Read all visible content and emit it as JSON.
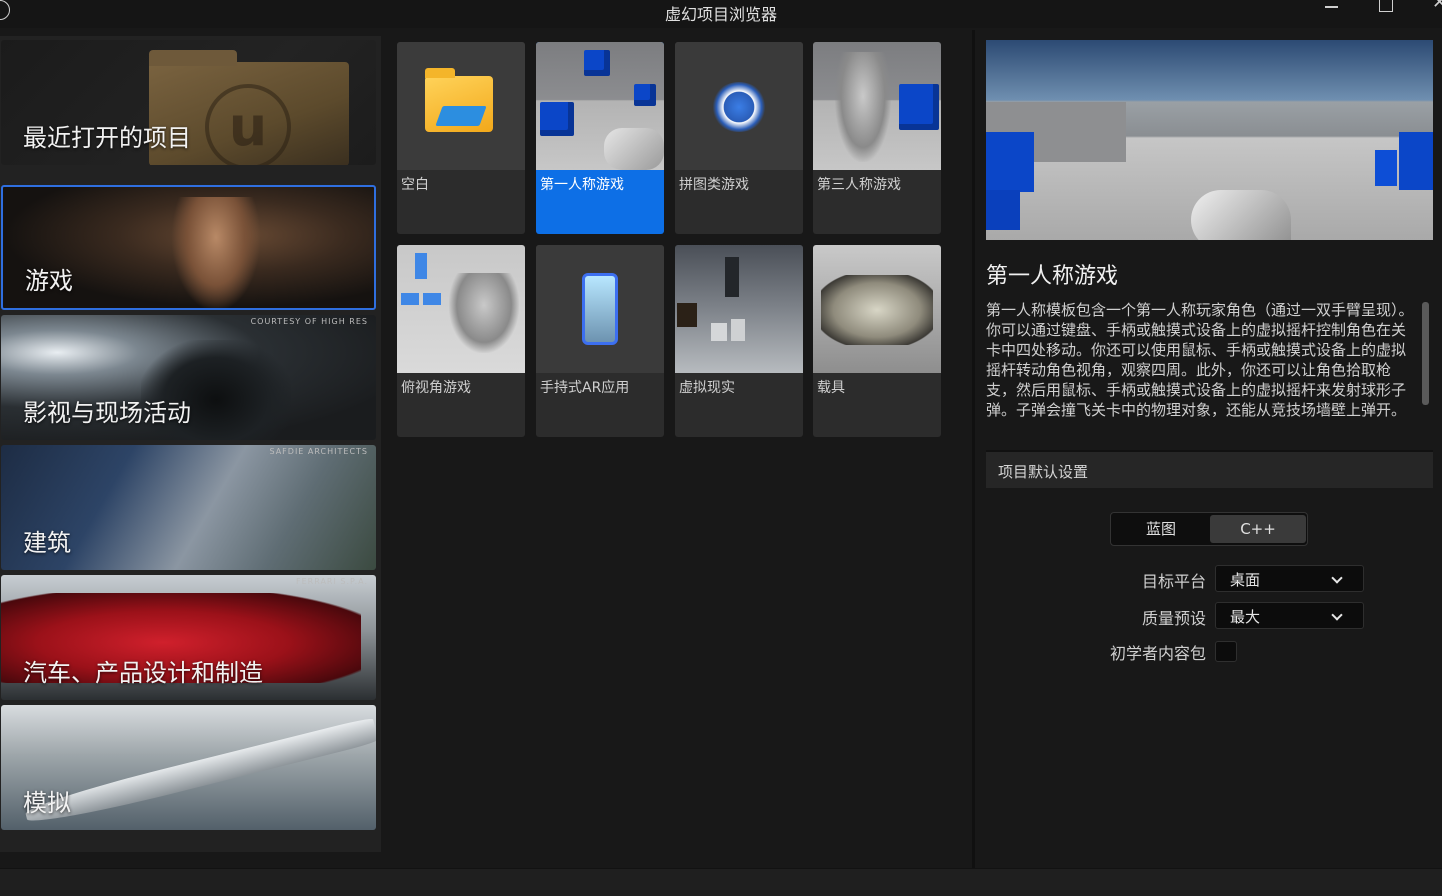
{
  "window": {
    "title": "虚幻项目浏览器"
  },
  "categories": [
    {
      "label": "最近打开的项目",
      "credit": ""
    },
    {
      "label": "游戏",
      "credit": ""
    },
    {
      "label": "影视与现场活动",
      "credit": "COURTESY OF HIGH RES"
    },
    {
      "label": "建筑",
      "credit": "SAFDIE ARCHITECTS"
    },
    {
      "label": "汽车、产品设计和制造",
      "credit": "FERRARI S.P.A."
    },
    {
      "label": "模拟",
      "credit": ""
    }
  ],
  "templates": [
    {
      "name": "空白"
    },
    {
      "name": "第一人称游戏"
    },
    {
      "name": "拼图类游戏"
    },
    {
      "name": "第三人称游戏"
    },
    {
      "name": "俯视角游戏"
    },
    {
      "name": "手持式AR应用"
    },
    {
      "name": "虚拟现实"
    },
    {
      "name": "载具"
    }
  ],
  "details": {
    "title": "第一人称游戏",
    "description": "第一人称模板包含一个第一人称玩家角色（通过一双手臂呈现）。你可以通过键盘、手柄或触摸式设备上的虚拟摇杆控制角色在关卡中四处移动。你还可以使用鼠标、手柄或触摸式设备上的虚拟摇杆转动角色视角，观察四周。此外，你还可以让角色拾取枪支，然后用鼠标、手柄或触摸式设备上的虚拟摇杆来发射球形子弹。子弹会撞飞关卡中的物理对象，还能从竞技场墙壁上弹开。",
    "section_title": "项目默认设置",
    "toggle": {
      "blueprint": "蓝图",
      "cpp": "C++",
      "selected": "C++"
    },
    "target_platform": {
      "label": "目标平台",
      "value": "桌面"
    },
    "quality_preset": {
      "label": "质量预设",
      "value": "最大"
    },
    "starter_content": {
      "label": "初学者内容包",
      "checked": false
    }
  },
  "colors": {
    "accent": "#0d6fe6",
    "selection_border": "#2f6fe0",
    "background": "#181818"
  }
}
